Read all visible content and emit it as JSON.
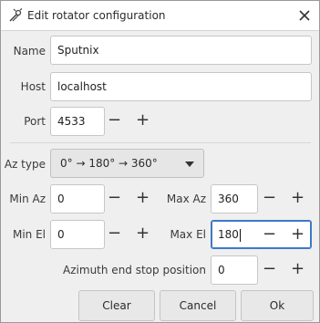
{
  "window": {
    "title": "Edit rotator configuration",
    "icon": "rotator-icon",
    "close_icon": "close-icon"
  },
  "form": {
    "name_label": "Name",
    "name_value": "Sputnix",
    "host_label": "Host",
    "host_value": "localhost",
    "port_label": "Port",
    "port_value": "4533",
    "az_type_label": "Az type",
    "az_type_value": "0° → 180° → 360°",
    "min_az_label": "Min Az",
    "min_az_value": "0",
    "max_az_label": "Max Az",
    "max_az_value": "360",
    "min_el_label": "Min El",
    "min_el_value": "0",
    "max_el_label": "Max El",
    "max_el_value": "180",
    "az_end_stop_label": "Azimuth end stop position",
    "az_end_stop_value": "0",
    "minus": "−",
    "plus": "+"
  },
  "buttons": {
    "clear": "Clear",
    "cancel": "Cancel",
    "ok": "Ok"
  },
  "colors": {
    "focus": "#3d79c9",
    "background": "#efefef"
  }
}
